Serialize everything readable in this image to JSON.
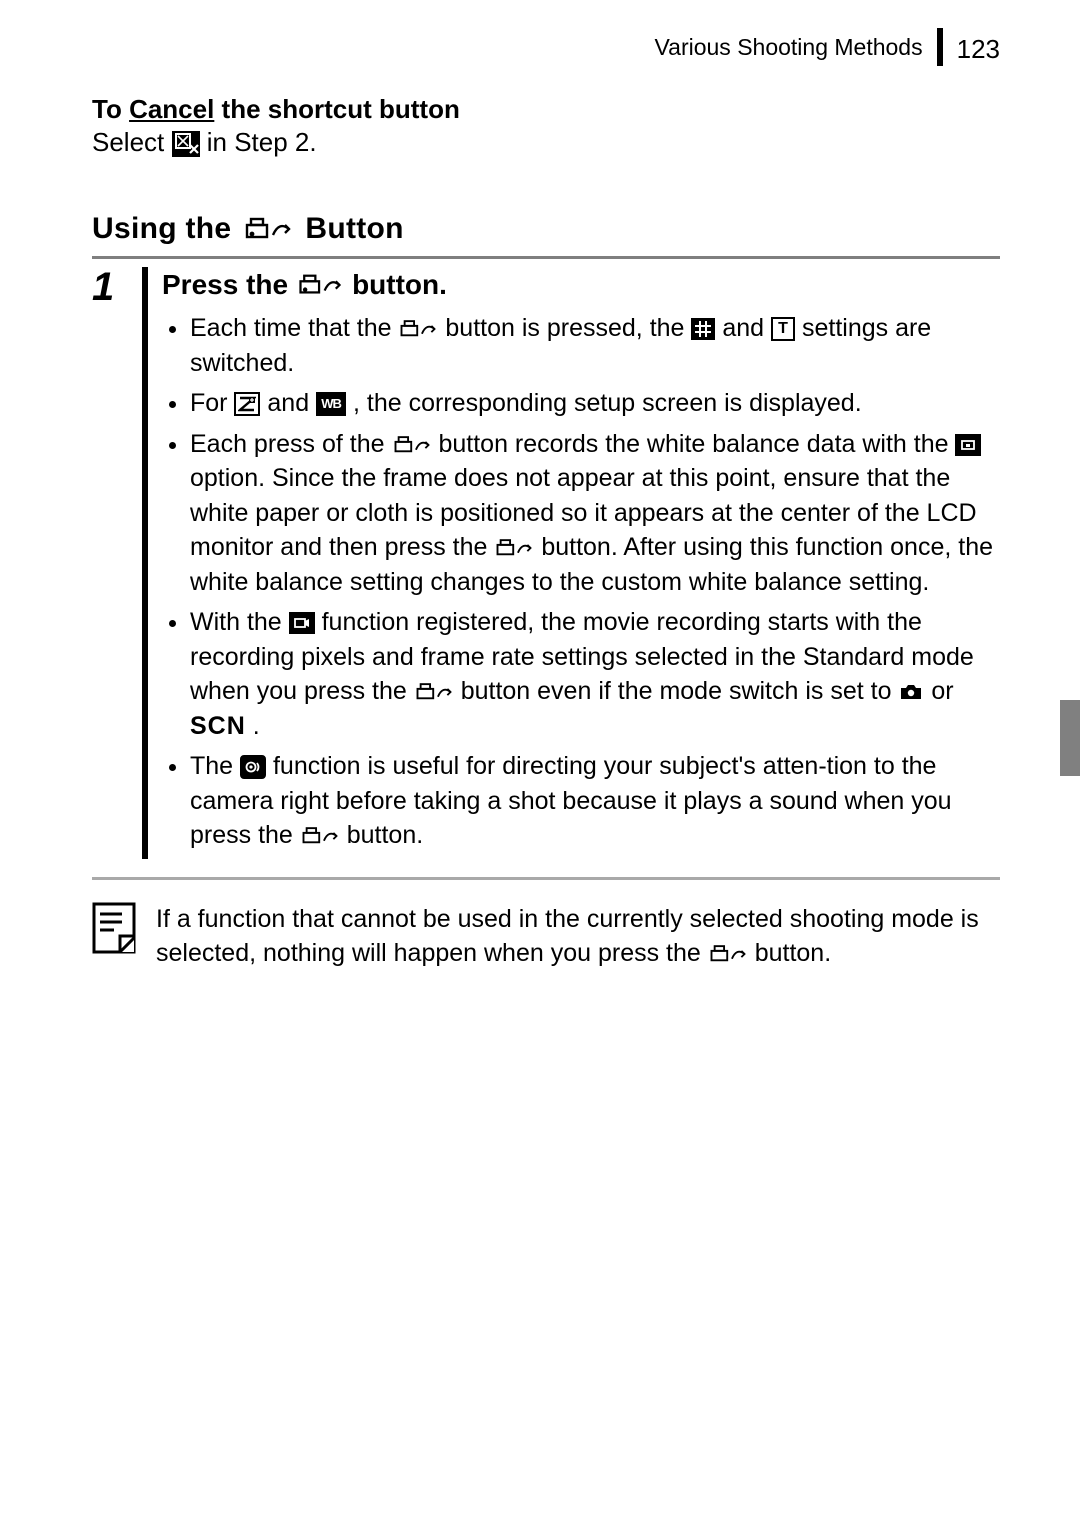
{
  "header": {
    "section": "Various Shooting Methods",
    "page": "123"
  },
  "cancel": {
    "title_pre": "To ",
    "title_u": "Cancel",
    "title_post": " the shortcut button",
    "line_pre": "Select ",
    "line_post": " in Step 2."
  },
  "section": {
    "pre": "Using the ",
    "post": " Button"
  },
  "step": {
    "num": "1",
    "title_pre": "Press the ",
    "title_post": " button."
  },
  "b1": {
    "a": "Each time that the ",
    "b": " button is pressed, the ",
    "c": " and ",
    "d": " settings are switched."
  },
  "b2": {
    "a": "For ",
    "b": " and ",
    "c": ", the corresponding setup screen is displayed."
  },
  "b3": {
    "a": "Each press of the ",
    "b": " button records the white balance data with the ",
    "c": " option. Since the frame does not appear at this point, ensure that the white paper or cloth is positioned so it appears at the center of the LCD monitor and then press the ",
    "d": " button. After using this function once, the white balance setting changes to the custom white balance setting."
  },
  "b4": {
    "a": "With the ",
    "b": " function registered, the movie recording starts with the recording pixels and frame rate settings selected in the Standard mode when you press the ",
    "c": " button even if the mode switch is set to ",
    "d": " or ",
    "e": "SCN",
    "f": "."
  },
  "b5": {
    "a": "The ",
    "b": " function is useful for directing your subject's atten-tion to the camera right before taking a shot because it plays a sound when you press the ",
    "c": " button."
  },
  "note": {
    "a": "If a function that cannot be used in the currently selected shooting mode is selected, nothing will happen when you press the ",
    "b": " button."
  }
}
